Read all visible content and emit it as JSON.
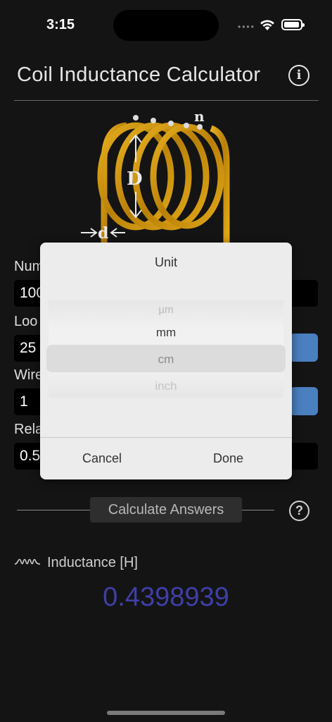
{
  "status": {
    "time": "3:15"
  },
  "header": {
    "title": "Coil Inductance Calculator"
  },
  "coil": {
    "label_n": "n",
    "label_D": "D",
    "label_d": "d"
  },
  "fields": [
    {
      "label": "Num",
      "value": "100"
    },
    {
      "label": "Loo",
      "value": "25"
    },
    {
      "label": "Wire",
      "value": "1"
    },
    {
      "label": "Rela",
      "value": "0.5"
    }
  ],
  "dialog": {
    "title": "Unit",
    "options": [
      "µm",
      "mm",
      "cm",
      "inch"
    ],
    "selected": "cm",
    "cancel_label": "Cancel",
    "done_label": "Done"
  },
  "calculate": {
    "label": "Calculate Answers"
  },
  "result": {
    "label": "Inductance [H]",
    "value": "0.4398939"
  },
  "colors": {
    "background": "#141414",
    "accent": "#4a7fc0",
    "result": "#3f3fa8",
    "coil": "#c8900a"
  }
}
